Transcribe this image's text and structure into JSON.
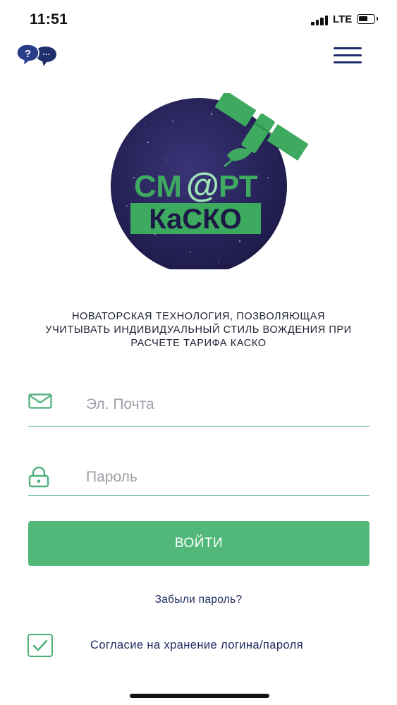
{
  "status_bar": {
    "time": "11:51",
    "network": "LTE",
    "icons": [
      "signal-icon",
      "battery-icon"
    ]
  },
  "header": {
    "help_icon_glyph": "?",
    "chat_icon_glyph": "···",
    "icons": [
      "help-chat-icon",
      "menu-icon"
    ],
    "accent_color": "#1f2f6b"
  },
  "logo": {
    "line1_left": "СМ",
    "line1_at": "@",
    "line1_right": "РТ",
    "line2": "КаСКО",
    "colors": {
      "circle": "#25204f",
      "green": "#3daa5f",
      "light_green": "#9fe3b6"
    }
  },
  "tagline": {
    "lines": [
      "НОВАТОРСКАЯ ТЕХНОЛОГИЯ,  ПОЗВОЛЯЮЩАЯ",
      "УЧИТЫВАТЬ ИНДИВИДУАЛЬНЫЙ СТИЛЬ ВОЖДЕНИЯ ПРИ",
      "РАСЧЕТЕ ТАРИФА КАСКО"
    ]
  },
  "form": {
    "email": {
      "placeholder": "Эл. Почта",
      "value": "",
      "icon": "envelope-icon"
    },
    "password": {
      "placeholder": "Пароль",
      "value": "",
      "icon": "lock-icon"
    },
    "login_button_label": "ВОЙТИ",
    "forgot_password_label": "Забыли пароль?",
    "remember_checked": true,
    "remember_label": "Согласие на хранение логина/пароля",
    "colors": {
      "primary": "#52b87a",
      "underline": "#4caf78",
      "link": "#1f2a60"
    }
  }
}
